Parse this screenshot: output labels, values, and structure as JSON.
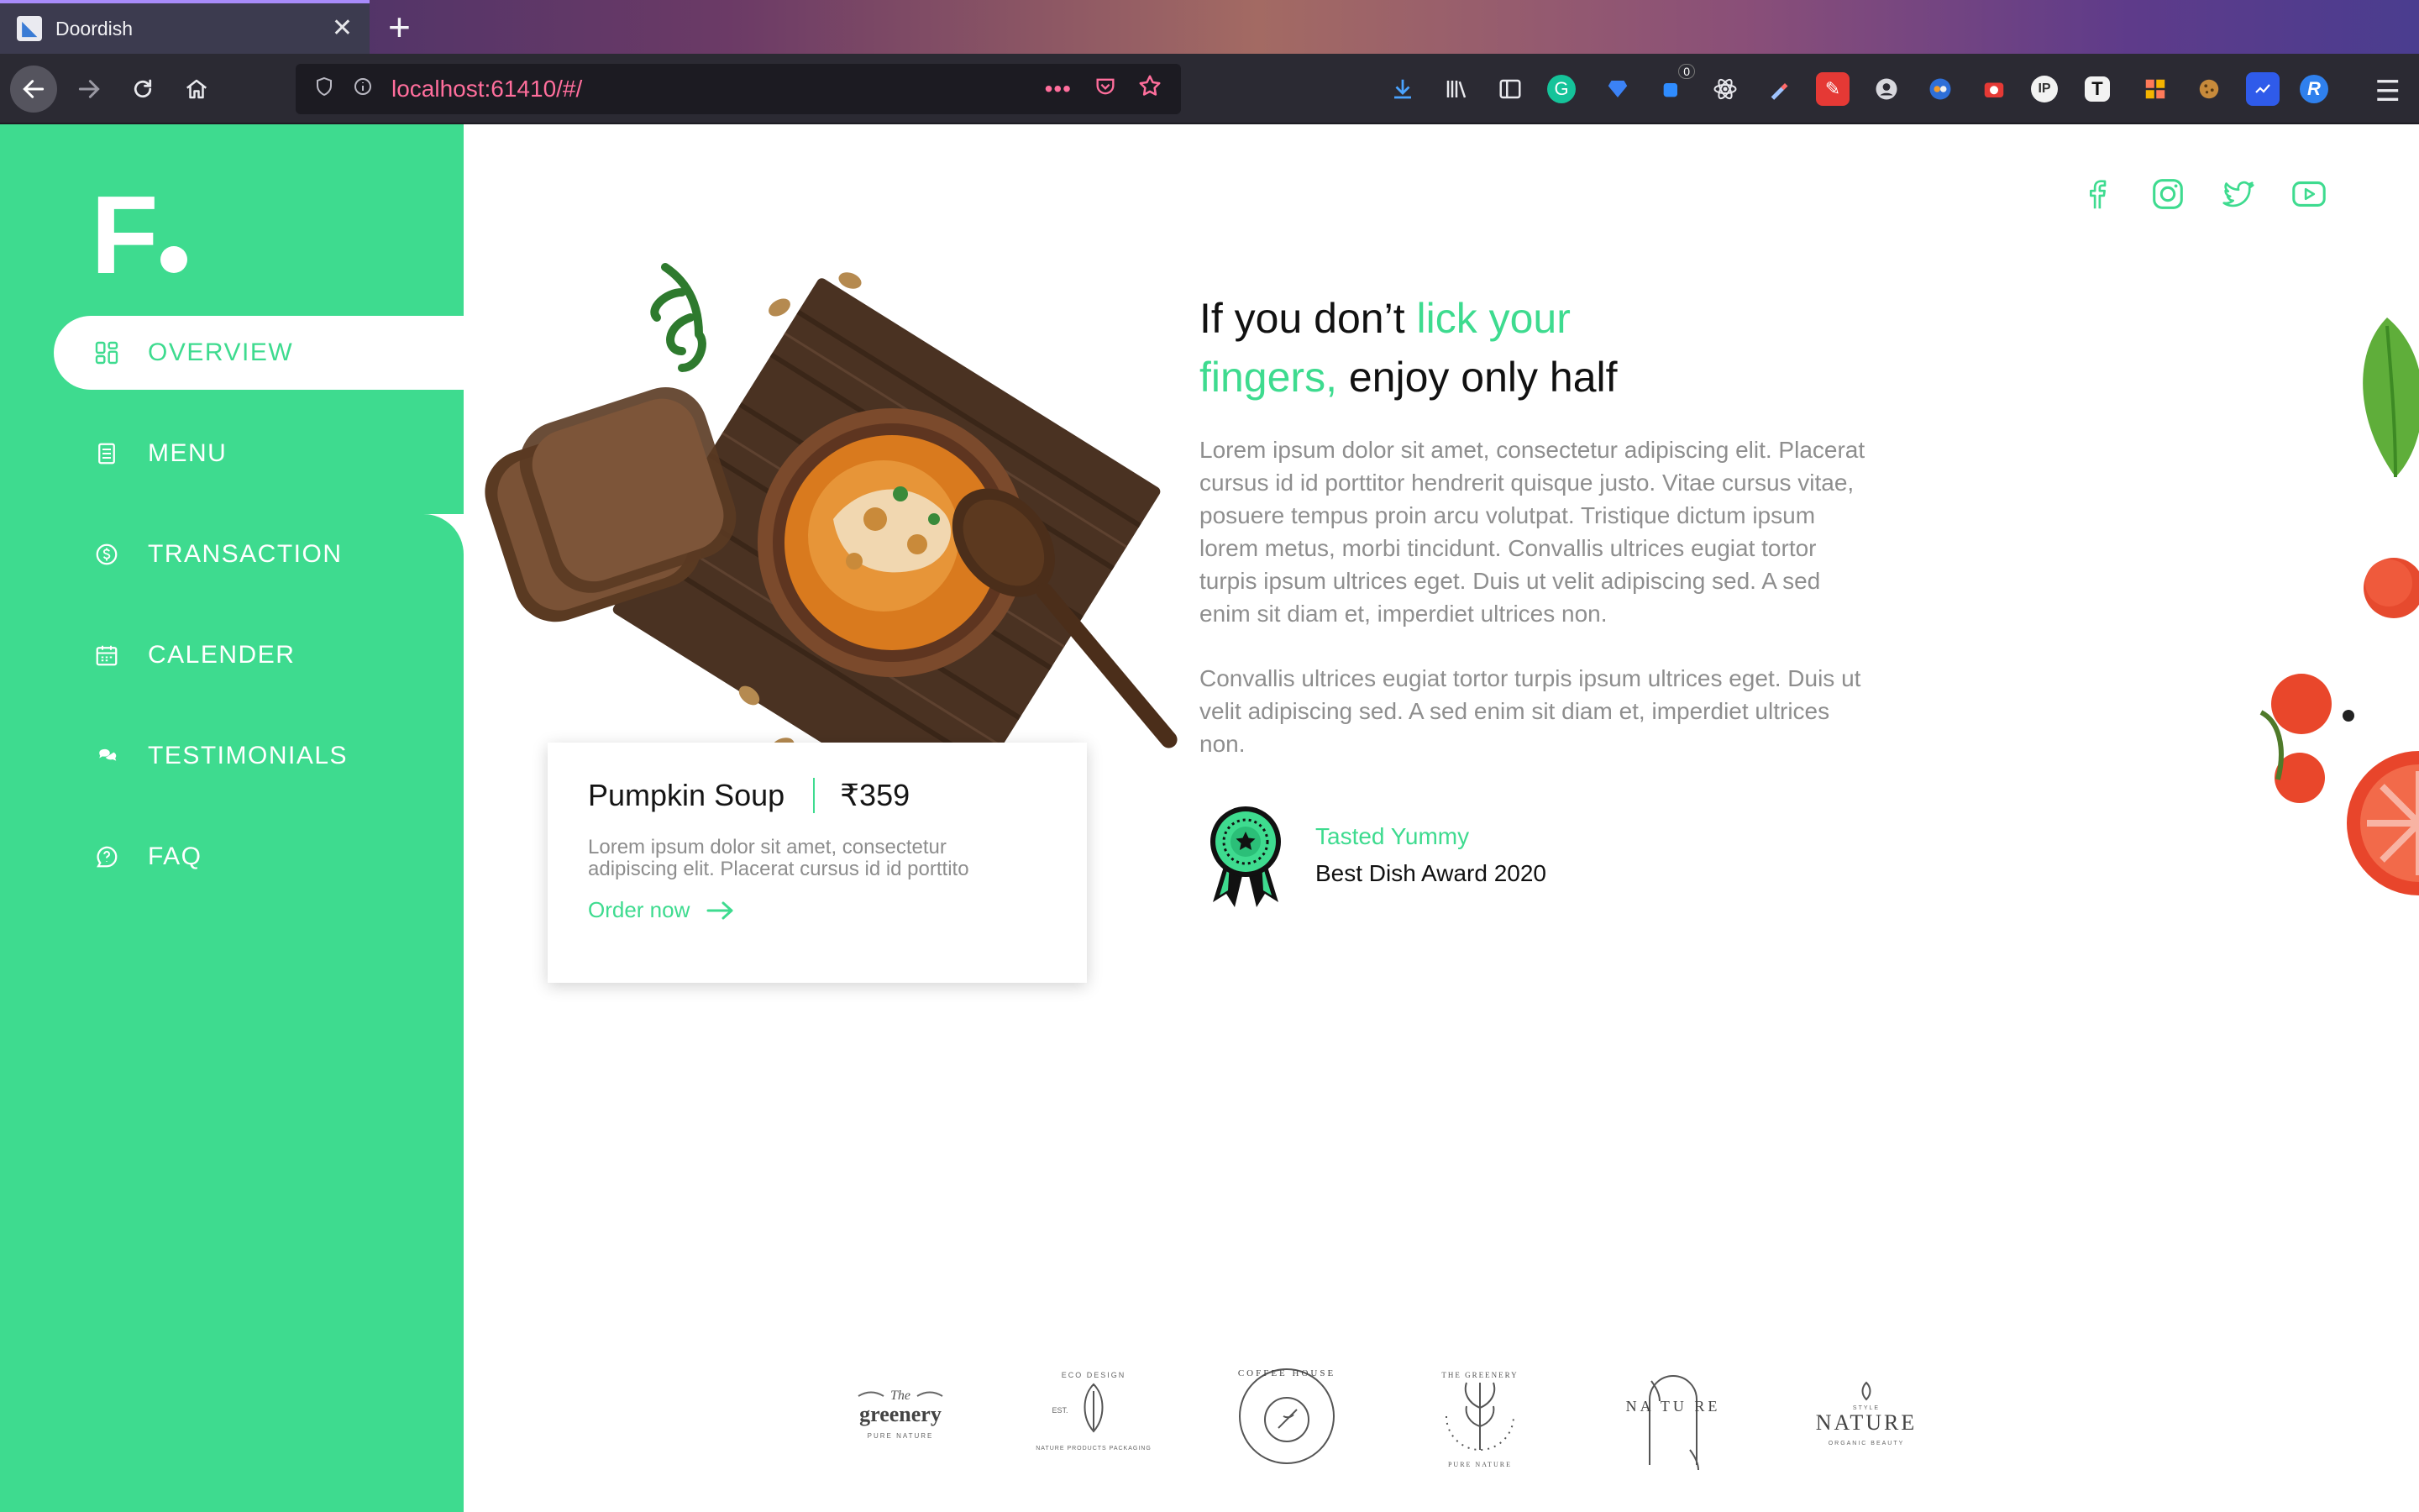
{
  "browser": {
    "tab_title": "Doordish",
    "new_tab_symbol": "+",
    "close_symbol": "✕",
    "url": "localhost:61410/#/",
    "url_more": "•••",
    "ext_badge_count": "0"
  },
  "app": {
    "logo_letter": "F",
    "accent_color": "#3edb8f"
  },
  "sidebar": {
    "items": [
      {
        "label": "OVERVIEW",
        "icon": "grid-icon",
        "active": true
      },
      {
        "label": "MENU",
        "icon": "document-icon",
        "active": false
      },
      {
        "label": "TRANSACTION",
        "icon": "dollar-coin-icon",
        "active": false
      },
      {
        "label": "CALENDER",
        "icon": "calendar-icon",
        "active": false
      },
      {
        "label": "TESTIMONIALS",
        "icon": "chat-icon",
        "active": false
      },
      {
        "label": "FAQ",
        "icon": "help-bubble-icon",
        "active": false
      }
    ]
  },
  "social": [
    "facebook-icon",
    "instagram-icon",
    "twitter-icon",
    "youtube-icon"
  ],
  "dish": {
    "name": "Pumpkin Soup",
    "price": "₹359",
    "description": "Lorem ipsum dolor sit amet, consectetur adipiscing elit. Placerat cursus id id porttito",
    "cta": "Order now"
  },
  "hero": {
    "headline_part1": "If you don’t ",
    "headline_green1": "lick your",
    "headline_green2": "fingers,",
    "headline_part2": " enjoy only half",
    "paragraph1": "Lorem ipsum dolor sit amet, consectetur adipiscing elit. Placerat cursus id id porttitor hendrerit quisque justo. Vitae cursus vitae, posuere tempus proin arcu volutpat. Tristique dictum ipsum lorem metus, morbi tincidunt. Convallis ultrices eugiat tortor turpis ipsum ultrices eget. Duis ut velit adipiscing sed. A sed enim sit diam et, imperdiet ultrices non.",
    "paragraph2": "Convallis ultrices eugiat tortor turpis ipsum ultrices eget. Duis ut velit adipiscing sed. A sed enim sit diam et, imperdiet ultrices non."
  },
  "award": {
    "title": "Tasted Yummy",
    "subtitle": "Best Dish Award 2020"
  },
  "partners": [
    {
      "name": "greenery",
      "top": "The",
      "bottom": "PURE NATURE"
    },
    {
      "name": "ECO DESIGN",
      "top": "EST.",
      "bottom": "NATURE PRODUCTS PACKAGING"
    },
    {
      "name": "COFFEE HOUSE",
      "top": "",
      "bottom": ""
    },
    {
      "name": "THE GREENERY",
      "top": "",
      "bottom": "PURE NATURE"
    },
    {
      "name": "NA TU RE",
      "top": "",
      "bottom": ""
    },
    {
      "name": "NATURE",
      "top": "STYLE",
      "bottom": "ORGANIC BEAUTY"
    }
  ]
}
